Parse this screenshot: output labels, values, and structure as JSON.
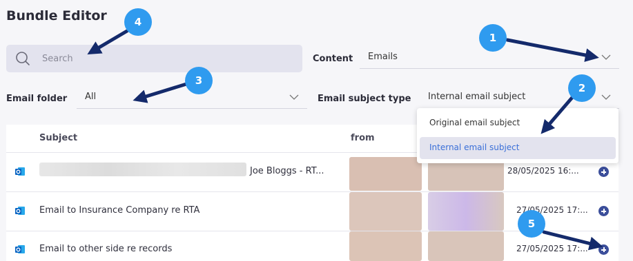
{
  "page": {
    "title": "Bundle Editor"
  },
  "search": {
    "placeholder": "Search",
    "value": ""
  },
  "content_filter": {
    "label": "Content",
    "value": "Emails"
  },
  "email_folder": {
    "label": "Email folder",
    "value": "All"
  },
  "subject_type": {
    "label": "Email subject type",
    "value": "Internal email subject",
    "options": [
      "Original email subject",
      "Internal email subject"
    ],
    "highlighted_index": 1
  },
  "table": {
    "headers": {
      "subject": "Subject",
      "from": "from"
    },
    "rows": [
      {
        "icon": "outlook-icon",
        "subject": "",
        "subject_blurred": true,
        "from": "Joe Bloggs - RT...",
        "date": "28/05/2025 16:..."
      },
      {
        "icon": "outlook-icon",
        "subject": "Email to Insurance Company re RTA",
        "subject_blurred": false,
        "from": "",
        "date": "27/05/2025 17:..."
      },
      {
        "icon": "outlook-icon",
        "subject": "Email to other side re records",
        "subject_blurred": false,
        "from": "",
        "date": "27/05/2025 17:..."
      }
    ]
  },
  "annotations": {
    "badges": [
      "1",
      "2",
      "3",
      "4",
      "5"
    ],
    "color": "#2f9bef",
    "arrow_color": "#142a6b"
  },
  "colors": {
    "accent": "#3b4e9a",
    "highlight_bg": "#e3e3ee",
    "highlight_text": "#3a6fd8"
  }
}
